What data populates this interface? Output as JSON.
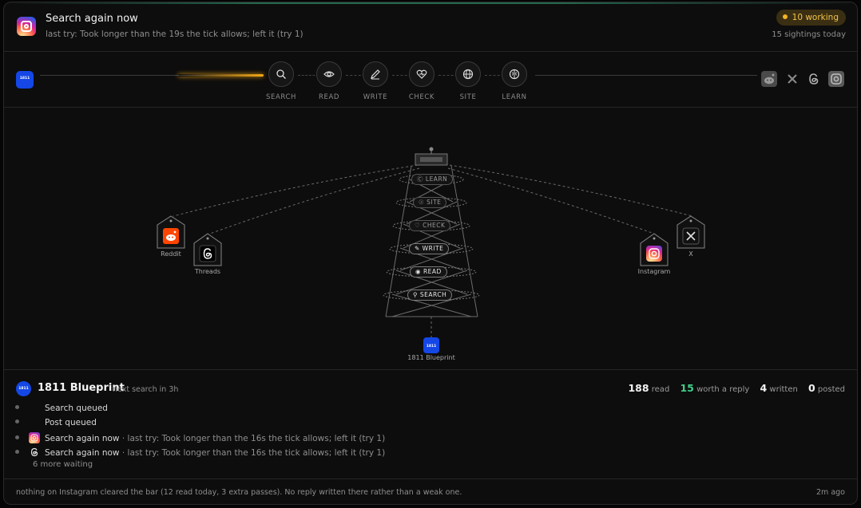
{
  "header": {
    "title": "Search again now",
    "subtitle": "last try: Took longer than the 19s the tick allows; left it (try 1)",
    "badge": "10 working",
    "count": "15 sightings today"
  },
  "pipeline": {
    "steps": [
      {
        "label": "SEARCH",
        "icon": "search-icon"
      },
      {
        "label": "READ",
        "icon": "eye-icon"
      },
      {
        "label": "WRITE",
        "icon": "pencil-icon"
      },
      {
        "label": "CHECK",
        "icon": "heart-check-icon"
      },
      {
        "label": "SITE",
        "icon": "globe-icon"
      },
      {
        "label": "LEARN",
        "icon": "brain-icon"
      }
    ],
    "platforms": [
      "reddit-icon",
      "x-icon",
      "threads-icon",
      "instagram-icon"
    ]
  },
  "diagram": {
    "rungs": [
      "LEARN",
      "SITE",
      "CHECK",
      "WRITE",
      "READ",
      "SEARCH"
    ],
    "nodes": {
      "reddit": "Reddit",
      "threads": "Threads",
      "instagram": "Instagram",
      "x": "X",
      "base": "1811 Blueprint"
    }
  },
  "footer": {
    "name": "1811 Blueprint",
    "next": "next search in 3h",
    "stats": {
      "read_num": "188",
      "read_label": "read",
      "worth_num": "15",
      "worth_label": "worth a reply",
      "written_num": "4",
      "written_label": "written",
      "posted_num": "0",
      "posted_label": "posted"
    },
    "queue": [
      {
        "title": "Search queued"
      },
      {
        "title": "Post queued"
      },
      {
        "title": "Search again now",
        "meta": " · last try: Took longer than the 16s the tick allows; left it (try 1)",
        "icon": "instagram-icon"
      },
      {
        "title": "Search again now",
        "meta": " · last try: Took longer than the 16s the tick allows; left it (try 1)",
        "icon": "threads-icon"
      }
    ],
    "more": "6 more waiting"
  },
  "bottom": {
    "message": "nothing on Instagram cleared the bar (12 read today, 3 extra passes). No reply written there rather than a weak one.",
    "time": "2m ago"
  },
  "colors": {
    "accent_amber": "#f3a815",
    "green": "#3fd08a",
    "brand_blue": "#1447e6"
  }
}
